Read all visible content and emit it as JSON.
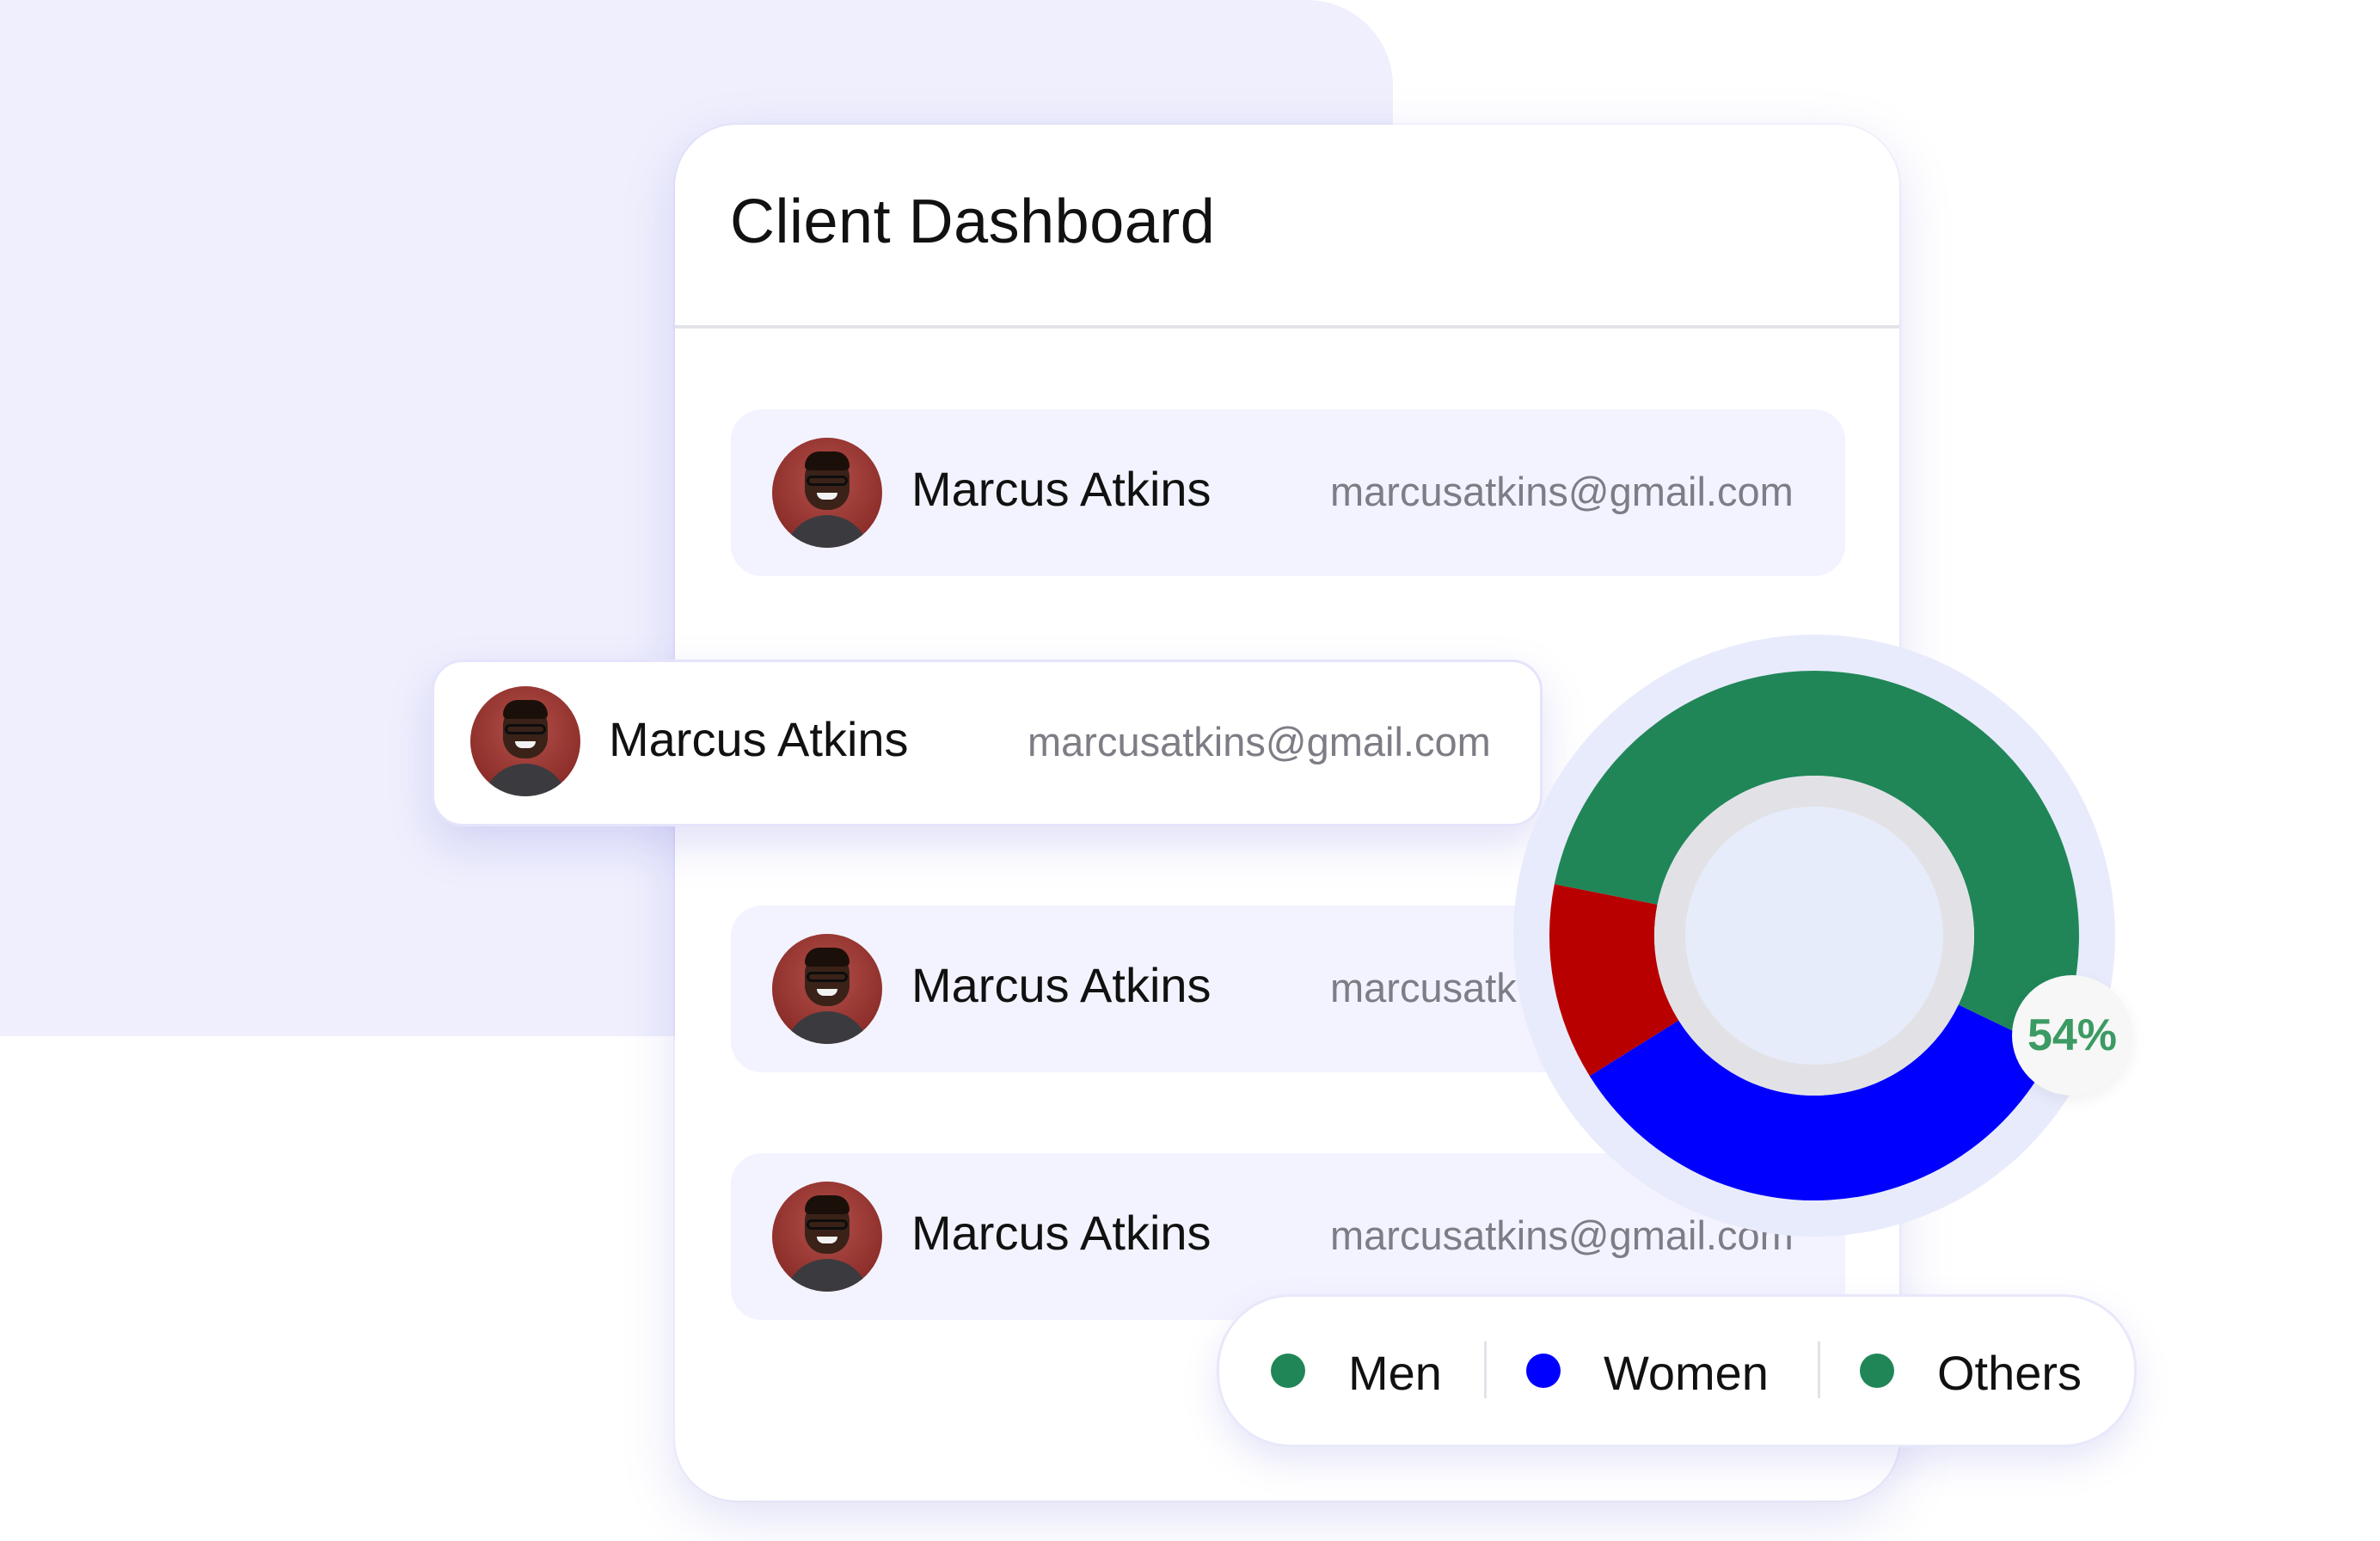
{
  "card": {
    "title": "Client Dashboard"
  },
  "clients": [
    {
      "name": "Marcus Atkins",
      "email": "marcusatkins@gmail.com"
    },
    {
      "name": "Marcus Atkins",
      "email": "marcusatkins@gmail.com"
    },
    {
      "name": "Marcus Atkins",
      "email": "marcusatk"
    },
    {
      "name": "Marcus Atkins",
      "email": "marcusatkins@gmail.com"
    }
  ],
  "chart_data": {
    "type": "pie",
    "segments": [
      {
        "label": "Women",
        "value": 34,
        "color": "#0000ff"
      },
      {
        "label": "Men",
        "value": 12,
        "color": "#b80000"
      },
      {
        "label": "Others",
        "value": 54,
        "color": "#208658"
      }
    ],
    "highlight_label": "54%"
  },
  "legend": {
    "items": [
      {
        "label": "Men",
        "color": "#208658"
      },
      {
        "label": "Women",
        "color": "#0000ff"
      },
      {
        "label": "Others",
        "color": "#208658"
      }
    ]
  },
  "colors": {
    "accent_background": "#efeffd",
    "row_background": "#f3f3ff",
    "badge_text": "#3c9a63"
  }
}
